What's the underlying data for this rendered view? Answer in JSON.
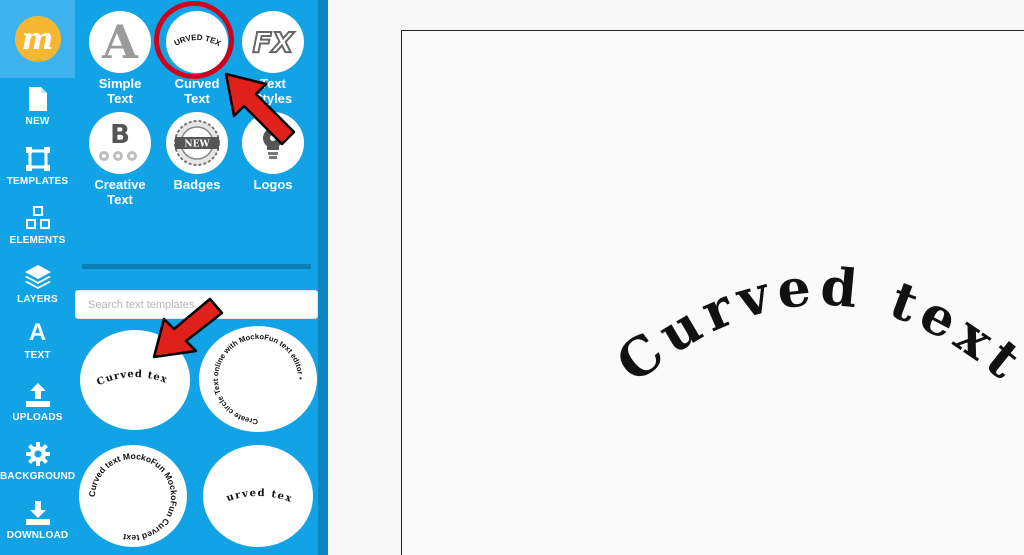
{
  "logo": {
    "letter": "m"
  },
  "rail": [
    {
      "label": "NEW",
      "icon": "document-icon"
    },
    {
      "label": "TEMPLATES",
      "icon": "templates-icon"
    },
    {
      "label": "ELEMENTS",
      "icon": "cubes-icon"
    },
    {
      "label": "LAYERS",
      "icon": "layers-icon"
    },
    {
      "label": "TEXT",
      "icon": "text-a-icon",
      "glyph": "A"
    },
    {
      "label": "UPLOADS",
      "icon": "upload-icon"
    },
    {
      "label": "BACKGROUND",
      "icon": "gear-icon"
    },
    {
      "label": "DOWNLOAD",
      "icon": "download-icon"
    }
  ],
  "tools": [
    {
      "label": "Simple Text",
      "line1": "Simple",
      "line2": "Text",
      "glyph": "A"
    },
    {
      "label": "Curved Text",
      "line1": "Curved",
      "line2": "Text",
      "glyph": "CURVED TEXT",
      "selected": true
    },
    {
      "label": "Text Styles",
      "line1": "Text",
      "line2": "Styles",
      "glyph": "FX"
    },
    {
      "label": "Creative Text",
      "line1": "Creative",
      "line2": "Text",
      "glyph": "B"
    },
    {
      "label": "Badges",
      "line1": "Badges",
      "line2": "",
      "glyph": "NEW"
    },
    {
      "label": "Logos",
      "line1": "Logos",
      "line2": "",
      "glyph": "lightbulb"
    }
  ],
  "search": {
    "placeholder": "Search text templates"
  },
  "templates": [
    {
      "text": "Curved text",
      "style": "arc"
    },
    {
      "text": "Create circle Text online with MockoFun text editor •",
      "style": "circle"
    },
    {
      "text": "Curved text MockoFun MockoFun Curved text",
      "style": "circle"
    },
    {
      "text": "Curved text",
      "style": "arc"
    }
  ],
  "canvas": {
    "text": "Curved text"
  },
  "colors": {
    "panel": "#12a3e6",
    "logo_bg": "#f7b733",
    "highlight": "#d0021b"
  }
}
